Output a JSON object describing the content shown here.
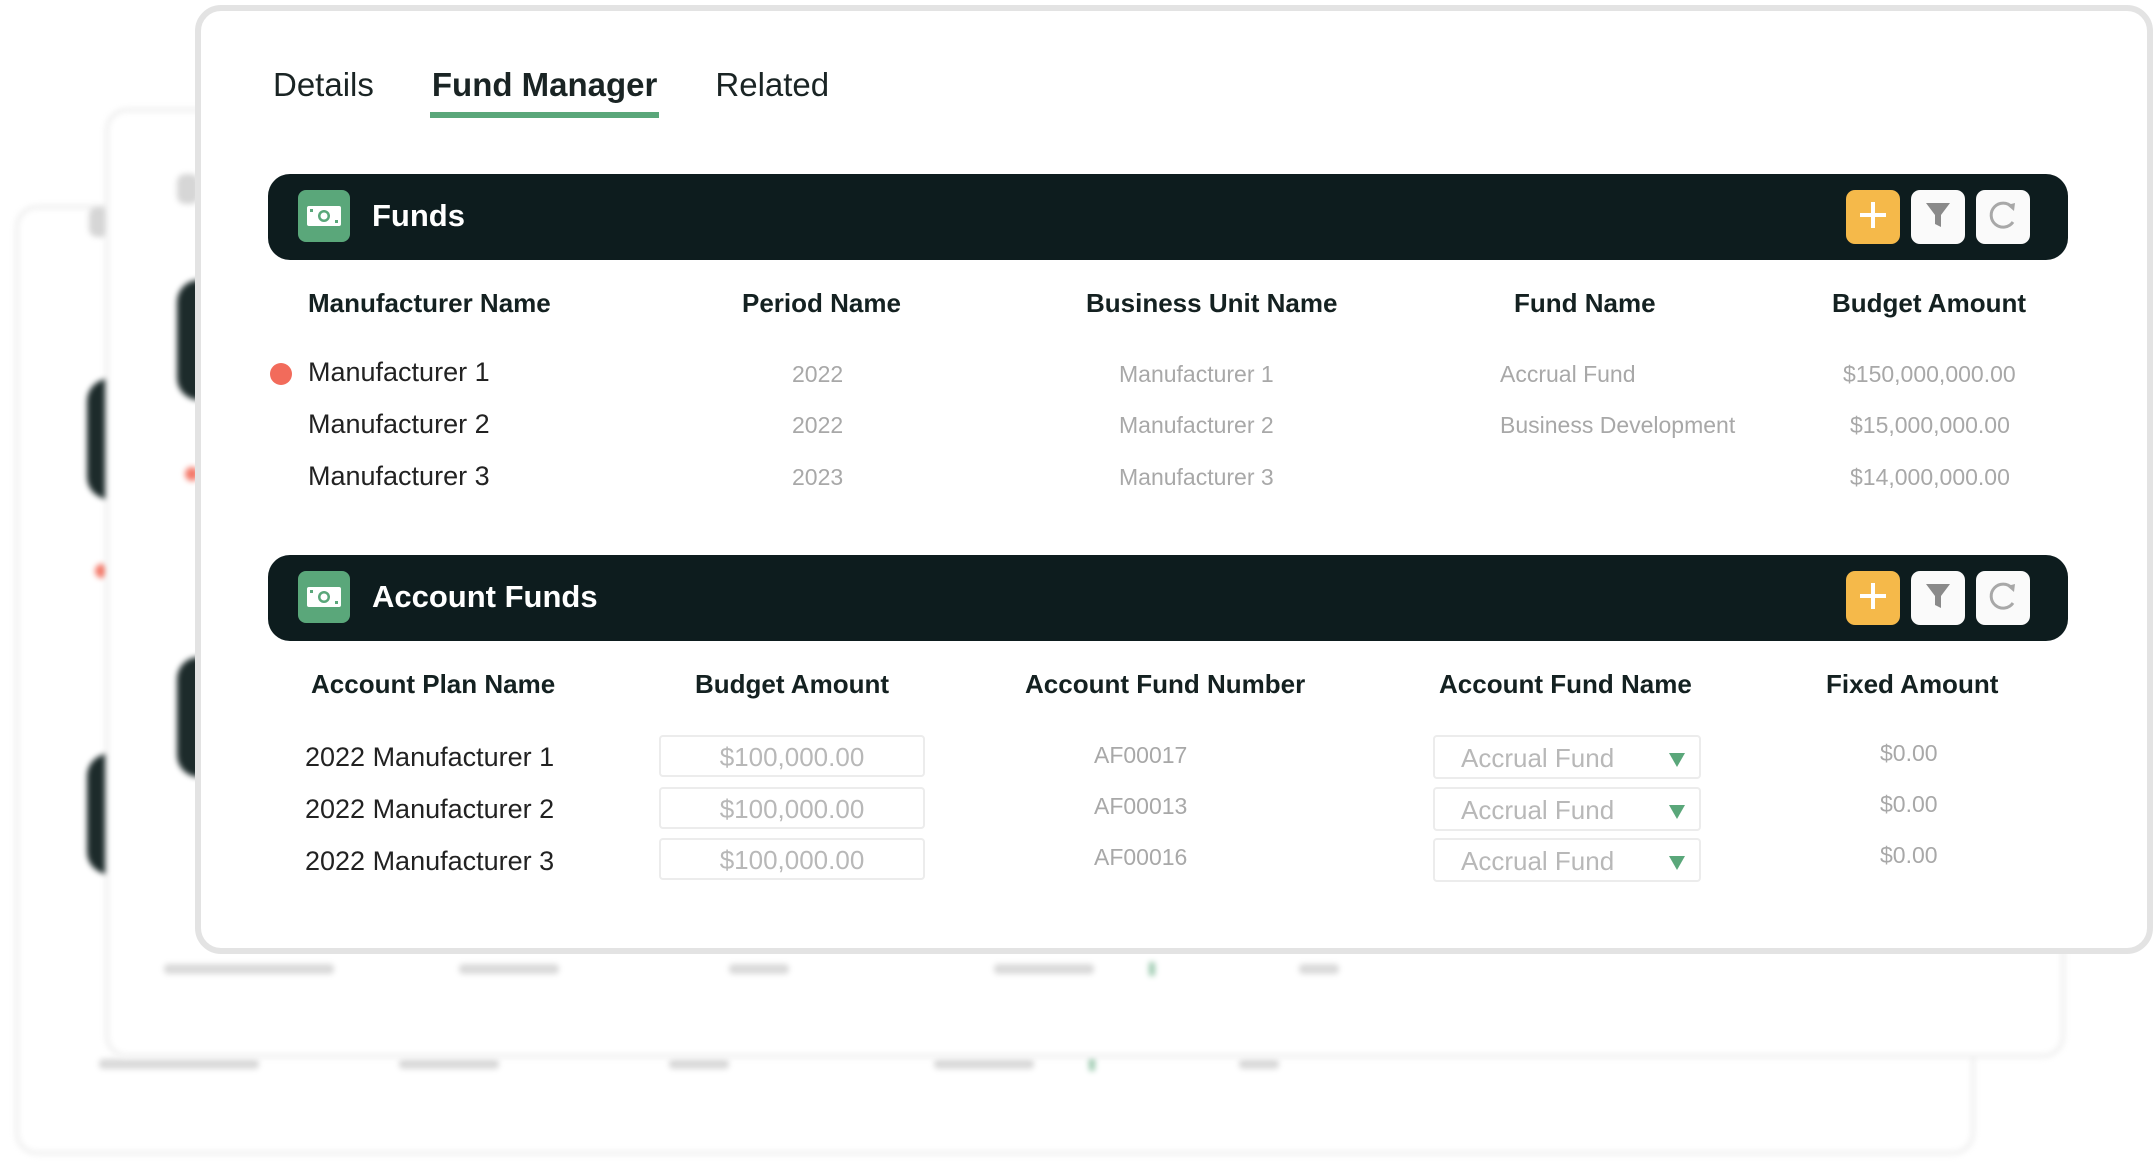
{
  "tabs": [
    {
      "label": "Details",
      "active": false
    },
    {
      "label": "Fund Manager",
      "active": true
    },
    {
      "label": "Related",
      "active": false
    }
  ],
  "funds": {
    "title": "Funds",
    "icon": "money-icon",
    "actions": {
      "add": "plus-icon",
      "filter": "filter-icon",
      "refresh": "refresh-icon"
    },
    "columns": [
      "Manufacturer Name",
      "Period Name",
      "Business Unit Name",
      "Fund Name",
      "Budget Amount"
    ],
    "rows": [
      {
        "manufacturer": "Manufacturer 1",
        "period": "2022",
        "business_unit": "Manufacturer 1",
        "fund_name": "Accrual Fund",
        "budget": "$150,000,000.00",
        "flagged": true
      },
      {
        "manufacturer": "Manufacturer 2",
        "period": "2022",
        "business_unit": "Manufacturer 2",
        "fund_name": "Business Development",
        "budget": "$15,000,000.00",
        "flagged": false
      },
      {
        "manufacturer": "Manufacturer 3",
        "period": "2023",
        "business_unit": "Manufacturer 3",
        "fund_name": "",
        "budget": "$14,000,000.00",
        "flagged": false
      }
    ]
  },
  "account_funds": {
    "title": "Account Funds",
    "icon": "money-icon",
    "actions": {
      "add": "plus-icon",
      "filter": "filter-icon",
      "refresh": "refresh-icon"
    },
    "columns": [
      "Account Plan Name",
      "Budget Amount",
      "Account Fund Number",
      "Account Fund Name",
      "Fixed Amount"
    ],
    "rows": [
      {
        "plan": "2022 Manufacturer 1",
        "budget": "$100,000.00",
        "number": "AF00017",
        "fund_name": "Accrual Fund",
        "fixed": "$0.00"
      },
      {
        "plan": "2022 Manufacturer 2",
        "budget": "$100,000.00",
        "number": "AF00013",
        "fund_name": "Accrual Fund",
        "fixed": "$0.00"
      },
      {
        "plan": "2022 Manufacturer 3",
        "budget": "$100,000.00",
        "number": "AF00016",
        "fund_name": "Accrual Fund",
        "fixed": "$0.00"
      }
    ]
  },
  "colors": {
    "header_bar": "#0d1c1e",
    "accent_green": "#5aa77a",
    "add_button": "#f5b94a",
    "flag_dot": "#f26b5b"
  }
}
